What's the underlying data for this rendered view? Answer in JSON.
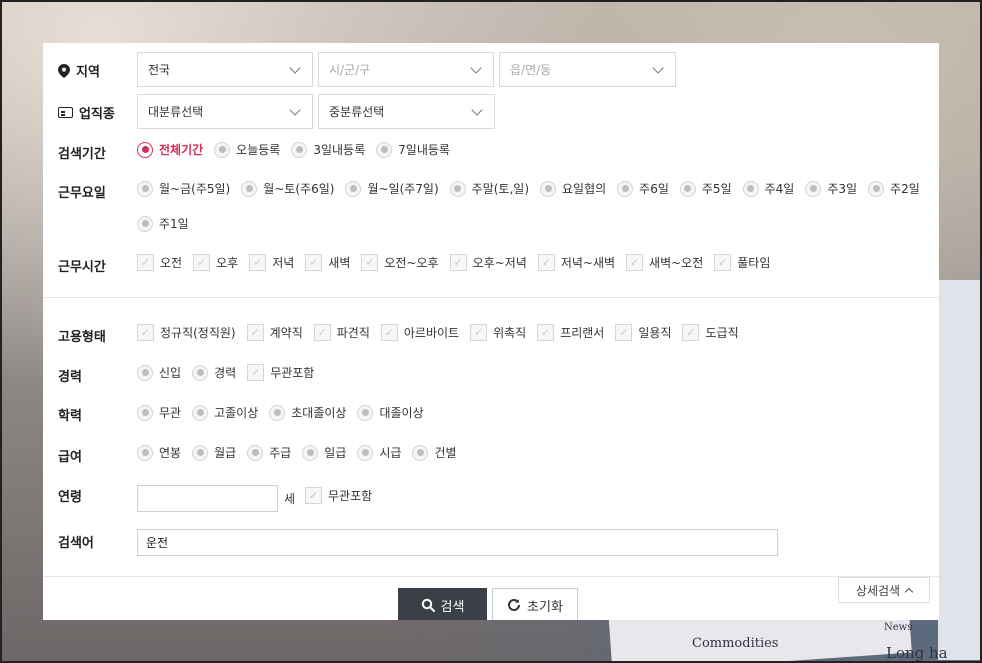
{
  "filters": {
    "region": {
      "label": "지역",
      "selects": [
        {
          "value": "전국",
          "dim": false
        },
        {
          "value": "시/군/구",
          "dim": true
        },
        {
          "value": "읍/면/동",
          "dim": true
        }
      ]
    },
    "industry": {
      "label": "업직종",
      "selects": [
        {
          "value": "대분류선택",
          "dim": false
        },
        {
          "value": "중분류선택",
          "dim": false
        }
      ]
    },
    "period": {
      "label": "검색기간",
      "options": [
        "전체기간",
        "오늘등록",
        "3일내등록",
        "7일내등록"
      ],
      "selected": 0
    },
    "workdays": {
      "label": "근무요일",
      "options": [
        "월~금(주5일)",
        "월~토(주6일)",
        "월~일(주7일)",
        "주말(토,일)",
        "요일협의",
        "주6일",
        "주5일",
        "주4일",
        "주3일",
        "주2일",
        "주1일"
      ]
    },
    "worktime": {
      "label": "근무시간",
      "options": [
        "오전",
        "오후",
        "저녁",
        "새벽",
        "오전~오후",
        "오후~저녁",
        "저녁~새벽",
        "새벽~오전",
        "풀타임"
      ]
    },
    "employment": {
      "label": "고용형태",
      "options": [
        "정규직(정직원)",
        "계약직",
        "파견직",
        "아르바이트",
        "위촉직",
        "프리랜서",
        "일용직",
        "도급직"
      ]
    },
    "career": {
      "label": "경력",
      "options": [
        "신입",
        "경력"
      ],
      "check": "무관포함"
    },
    "education": {
      "label": "학력",
      "options": [
        "무관",
        "고졸이상",
        "초대졸이상",
        "대졸이상"
      ]
    },
    "salary": {
      "label": "급여",
      "options": [
        "연봉",
        "월급",
        "주급",
        "일급",
        "시급",
        "건별"
      ]
    },
    "age": {
      "label": "연령",
      "value": "",
      "unit": "세",
      "check": "무관포함"
    },
    "keyword": {
      "label": "검색어",
      "value": "운전"
    }
  },
  "buttons": {
    "search": "검색",
    "reset": "초기화",
    "detail": "상세검색"
  },
  "background_text": [
    "Commodities",
    "News",
    "Long ha"
  ]
}
